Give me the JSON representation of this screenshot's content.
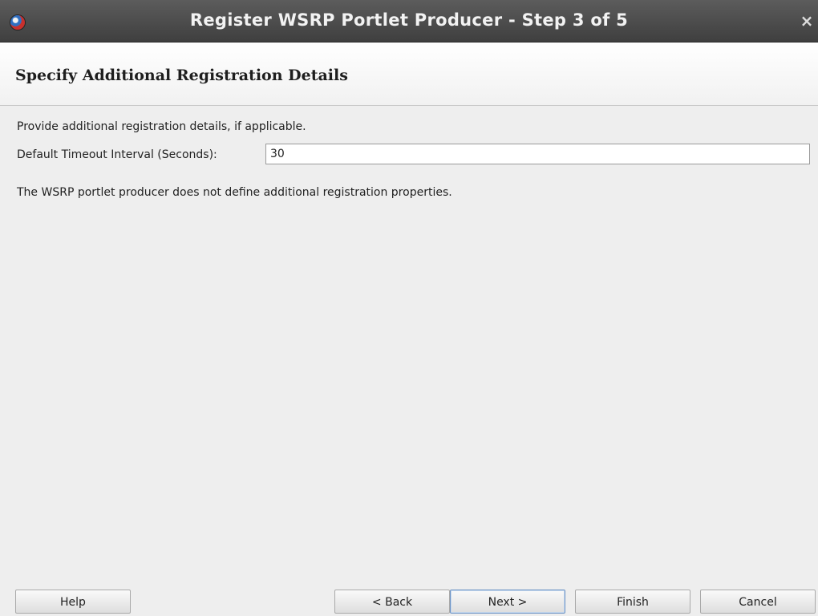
{
  "window": {
    "title": "Register WSRP Portlet Producer - Step 3 of 5",
    "close_glyph": "×",
    "app_icon": "oracle-jdeveloper-icon"
  },
  "header": {
    "title": "Specify Additional Registration Details"
  },
  "content": {
    "intro": "Provide additional registration details, if applicable.",
    "timeout_label": "Default Timeout Interval (Seconds):",
    "timeout_value": "30",
    "note": "The WSRP portlet producer does not define additional registration properties."
  },
  "buttons": {
    "help": "Help",
    "back": "< Back",
    "next": "Next >",
    "finish": "Finish",
    "cancel": "Cancel"
  },
  "colors": {
    "titlebar": "#4a4a4a",
    "title_text": "#f2f2f2",
    "default_button_border": "#6e94c4"
  }
}
